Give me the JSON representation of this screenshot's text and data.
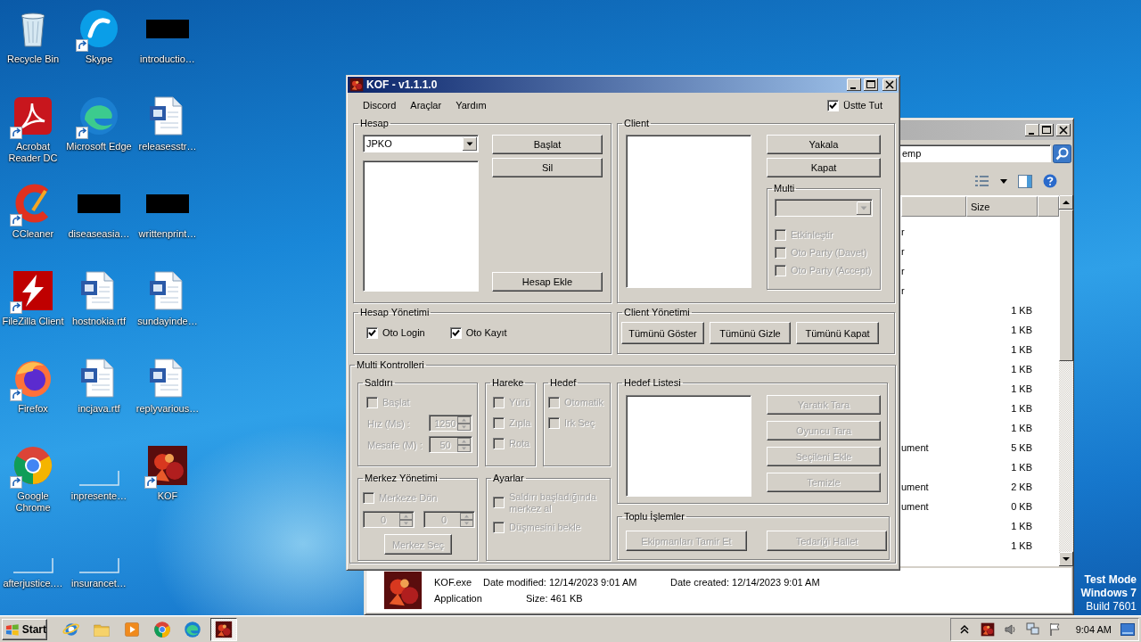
{
  "desktop": {
    "icons": [
      {
        "label": "Recycle Bin",
        "kind": "recycle",
        "shortcut": false
      },
      {
        "label": "Skype",
        "kind": "skype",
        "shortcut": true
      },
      {
        "label": "introductio…",
        "kind": "redacted",
        "shortcut": false
      },
      {
        "label": "Acrobat Reader DC",
        "kind": "acrobat",
        "shortcut": true
      },
      {
        "label": "Microsoft Edge",
        "kind": "edge",
        "shortcut": true
      },
      {
        "label": "releasesstr…",
        "kind": "word",
        "shortcut": false
      },
      {
        "label": "CCleaner",
        "kind": "ccleaner",
        "shortcut": true
      },
      {
        "label": "diseaseasia…",
        "kind": "redacted",
        "shortcut": false
      },
      {
        "label": "writtenprint…",
        "kind": "redacted",
        "shortcut": false
      },
      {
        "label": "FileZilla Client",
        "kind": "filezilla",
        "shortcut": true
      },
      {
        "label": "hostnokia.rtf",
        "kind": "word",
        "shortcut": false
      },
      {
        "label": "sundayinde…",
        "kind": "word",
        "shortcut": false
      },
      {
        "label": "Firefox",
        "kind": "firefox",
        "shortcut": true
      },
      {
        "label": "incjava.rtf",
        "kind": "word",
        "shortcut": false
      },
      {
        "label": "replyvarious…",
        "kind": "word",
        "shortcut": false
      },
      {
        "label": "Google Chrome",
        "kind": "chrome",
        "shortcut": true
      },
      {
        "label": "inpresente…",
        "kind": "blank",
        "shortcut": false
      },
      {
        "label": "KOF",
        "kind": "kof",
        "shortcut": true
      },
      {
        "label": "afterjustice.…",
        "kind": "blank",
        "shortcut": false
      },
      {
        "label": "insurancet…",
        "kind": "blank",
        "shortcut": false
      }
    ],
    "watermark": [
      "Test Mode",
      "Windows 7",
      "Build 7601"
    ]
  },
  "explorer": {
    "address": "emp",
    "size_header": "Size",
    "rows": [
      {
        "type": "r"
      },
      {
        "type": "r"
      },
      {
        "type": "r"
      },
      {
        "type": "r"
      },
      {
        "size": "1 KB"
      },
      {
        "size": "1 KB"
      },
      {
        "size": "1 KB"
      },
      {
        "size": "1 KB"
      },
      {
        "size": "1 KB"
      },
      {
        "size": "1 KB"
      },
      {
        "size": "1 KB"
      },
      {
        "type": "ument",
        "size": "5 KB"
      },
      {
        "size": "1 KB"
      },
      {
        "type": "ument",
        "size": "2 KB"
      },
      {
        "type": "ument",
        "size": "0 KB"
      },
      {
        "size": "1 KB"
      },
      {
        "size": "1 KB"
      }
    ],
    "details": {
      "name": "KOF.exe",
      "modified": "Date modified: 12/14/2023 9:01 AM",
      "created": "Date created: 12/14/2023 9:01 AM",
      "type": "Application",
      "size": "Size: 461 KB"
    }
  },
  "kof_window": {
    "title": "KOF - v1.1.1.0",
    "menu": [
      "Discord",
      "Araçlar",
      "Yardım"
    ],
    "stay_on_top": {
      "label": "Üstte Tut",
      "checked": true,
      "disabled": false
    },
    "account": {
      "title": "Hesap",
      "dropdown": {
        "value": "JPKO",
        "disabled": false
      },
      "buttons": [
        {
          "label": "Başlat",
          "disabled": false
        },
        {
          "label": "Sil",
          "disabled": false
        },
        {
          "label": "Hesap Ekle",
          "disabled": false
        }
      ]
    },
    "client": {
      "title": "Client",
      "buttons": [
        {
          "label": "Yakala",
          "disabled": false
        },
        {
          "label": "Kapat",
          "disabled": false
        }
      ],
      "multi": {
        "title": "Multi",
        "dropdown": {
          "disabled": true
        },
        "checks": [
          {
            "label": "Etkinleştir",
            "checked": false,
            "disabled": true
          },
          {
            "label": "Oto Party (Davet)",
            "checked": false,
            "disabled": true
          },
          {
            "label": "Oto Party (Accept)",
            "checked": false,
            "disabled": true
          }
        ]
      }
    },
    "account_management": {
      "title": "Hesap Yönetimi",
      "checks": [
        {
          "label": "Oto Login",
          "checked": true,
          "disabled": false
        },
        {
          "label": "Oto Kayıt",
          "checked": true,
          "disabled": false
        }
      ]
    },
    "client_management": {
      "title": "Client Yönetimi",
      "buttons": [
        {
          "label": "Tümünü Göster",
          "disabled": false
        },
        {
          "label": "Tümünü Gizle",
          "disabled": false
        },
        {
          "label": "Tümünü Kapat",
          "disabled": false
        }
      ]
    },
    "multi_controls": {
      "title": "Multi Kontrolleri",
      "attack": {
        "title": "Saldırı",
        "check": {
          "label": "Başlat",
          "checked": false,
          "disabled": true
        },
        "spins": [
          {
            "label": "Hız (Ms) :",
            "value": "1250",
            "disabled": true
          },
          {
            "label": "Mesafe (M) :",
            "value": "50",
            "disabled": true
          }
        ]
      },
      "movement": {
        "title": "Hareke",
        "checks": [
          {
            "label": "Yürü",
            "checked": false,
            "disabled": true
          },
          {
            "label": "Zıpla",
            "checked": false,
            "disabled": true
          },
          {
            "label": "Rota",
            "checked": false,
            "disabled": true
          }
        ]
      },
      "target": {
        "title": "Hedef",
        "checks": [
          {
            "label": "Otomatik",
            "checked": false,
            "disabled": true
          },
          {
            "label": "Irk Seç",
            "checked": false,
            "disabled": true
          }
        ]
      },
      "center": {
        "title": "Merkez Yönetimi",
        "check": {
          "label": "Merkeze Dön",
          "checked": false,
          "disabled": true
        },
        "spins": [
          {
            "value": "0",
            "disabled": true
          },
          {
            "value": "0",
            "disabled": true
          }
        ],
        "button": {
          "label": "Merkez Seç",
          "disabled": true
        }
      },
      "settings": {
        "title": "Ayarlar",
        "checks": [
          {
            "label": "Saldırı başladığında merkez al",
            "checked": false,
            "disabled": true
          },
          {
            "label": "Düşmesini bekle",
            "checked": false,
            "disabled": true
          }
        ]
      },
      "target_list": {
        "title": "Hedef Listesi",
        "buttons": [
          {
            "label": "Yaratık Tara",
            "disabled": true
          },
          {
            "label": "Oyuncu Tara",
            "disabled": true
          },
          {
            "label": "Seçileni Ekle",
            "disabled": true
          },
          {
            "label": "Temizle",
            "disabled": true
          }
        ]
      },
      "bulk": {
        "title": "Toplu İşlemler",
        "buttons": [
          {
            "label": "Ekipmanları Tamir Et",
            "disabled": true
          },
          {
            "label": "Tedariği Hallet",
            "disabled": true
          }
        ]
      }
    }
  },
  "taskbar": {
    "start": "Start",
    "quick_launch": [
      {
        "kind": "ie",
        "active": false
      },
      {
        "kind": "folder",
        "active": false
      },
      {
        "kind": "media",
        "active": false
      },
      {
        "kind": "chrome",
        "active": false
      },
      {
        "kind": "edge",
        "active": false
      },
      {
        "kind": "kof",
        "active": true
      }
    ],
    "tray": [
      {
        "kind": "chevron"
      },
      {
        "kind": "kof"
      },
      {
        "kind": "volume"
      },
      {
        "kind": "network"
      },
      {
        "kind": "flag"
      }
    ],
    "clock": "9:04 AM"
  }
}
